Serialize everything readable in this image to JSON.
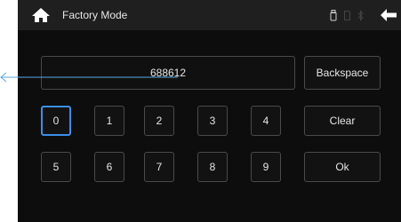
{
  "header": {
    "title": "Factory Mode",
    "icons": [
      "home-icon",
      "usb-icon",
      "sd-card-icon",
      "bluetooth-icon",
      "back-arrow-icon"
    ]
  },
  "display": {
    "value": "688612"
  },
  "keypad": {
    "row1": [
      "0",
      "1",
      "2",
      "3",
      "4"
    ],
    "row2": [
      "5",
      "6",
      "7",
      "8",
      "9"
    ],
    "backspace_label": "Backspace",
    "clear_label": "Clear",
    "ok_label": "Ok",
    "selected_key": "0"
  },
  "colors": {
    "background": "#0d0d0d",
    "topbar": "#1f1f1f",
    "key_border": "#4a4a4a",
    "selected_border": "#3b8fe8",
    "text": "#e6e6e6",
    "annotation_line": "#5aa8e6"
  }
}
